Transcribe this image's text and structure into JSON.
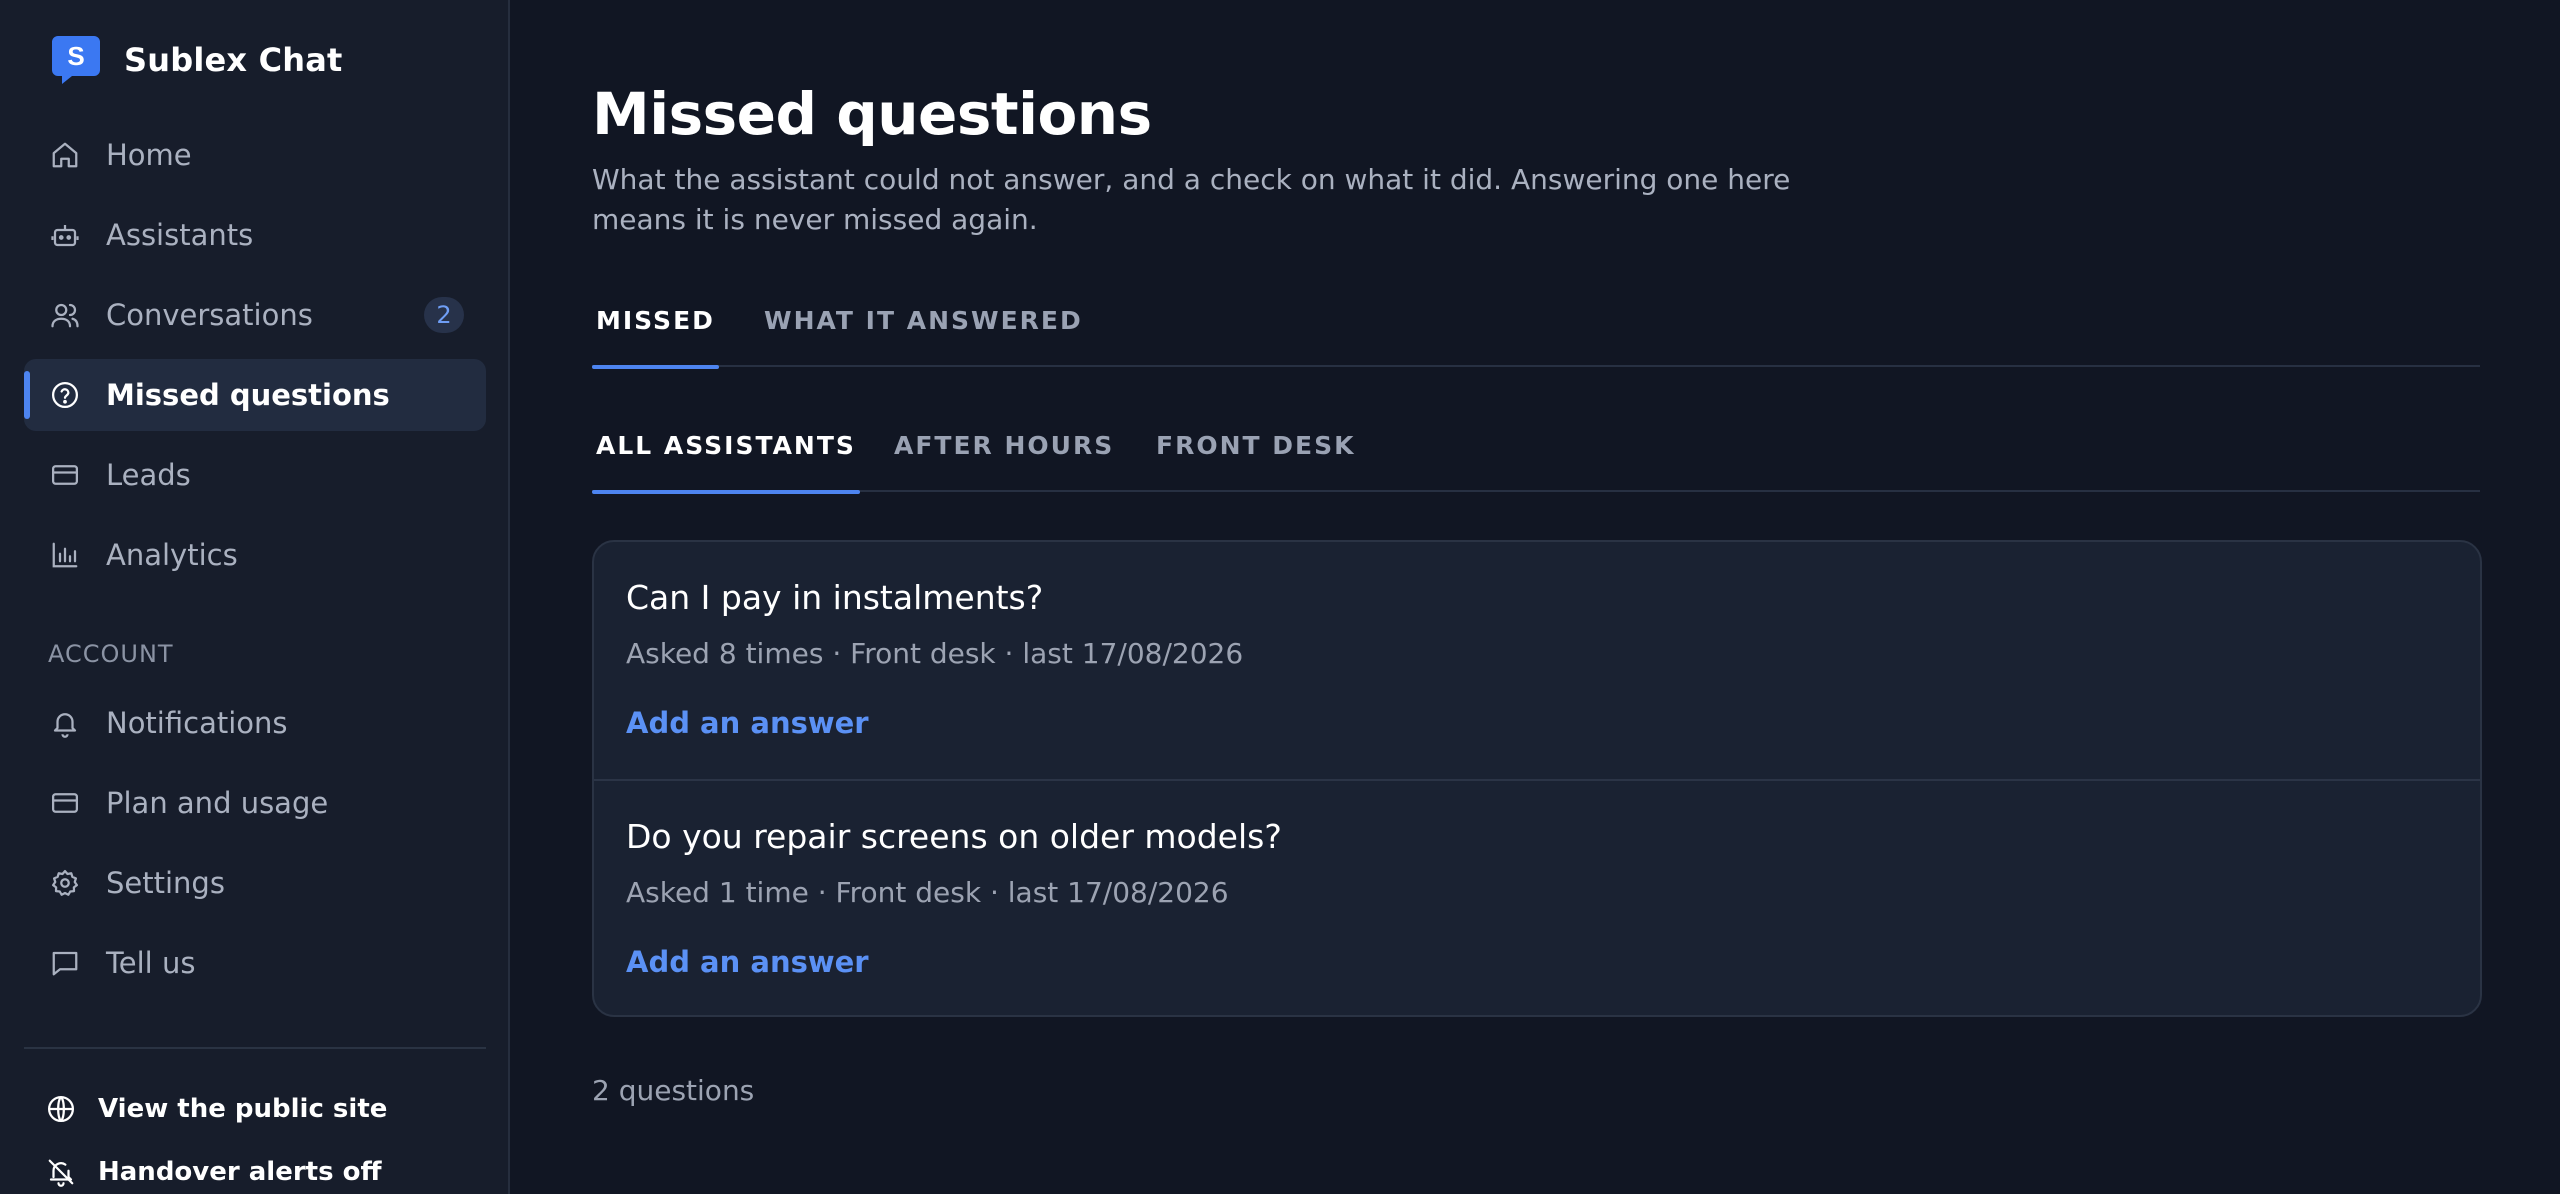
{
  "brand": {
    "name": "Sublex Chat",
    "logo_letter": "S"
  },
  "sidebar": {
    "items": [
      {
        "label": "Home",
        "icon": "home-icon"
      },
      {
        "label": "Assistants",
        "icon": "robot-icon"
      },
      {
        "label": "Conversations",
        "icon": "users-icon",
        "badge": "2"
      },
      {
        "label": "Missed questions",
        "icon": "help-circle-icon",
        "active": true
      },
      {
        "label": "Leads",
        "icon": "card-icon"
      },
      {
        "label": "Analytics",
        "icon": "bar-chart-icon"
      }
    ],
    "section_label": "ACCOUNT",
    "account_items": [
      {
        "label": "Notifications",
        "icon": "bell-icon"
      },
      {
        "label": "Plan and usage",
        "icon": "card-icon"
      },
      {
        "label": "Settings",
        "icon": "gear-icon"
      },
      {
        "label": "Tell us",
        "icon": "message-icon"
      }
    ],
    "footer": [
      {
        "label": "View the public site",
        "icon": "globe-icon"
      },
      {
        "label": "Handover alerts off",
        "icon": "bell-off-icon"
      }
    ]
  },
  "page": {
    "title": "Missed questions",
    "subtitle": "What the assistant could not answer, and a check on what it did. Answering one here means it is never missed again."
  },
  "tabs_primary": [
    {
      "label": "MISSED",
      "active": true
    },
    {
      "label": "WHAT IT ANSWERED",
      "active": false
    }
  ],
  "tabs_secondary": [
    {
      "label": "ALL ASSISTANTS",
      "active": true
    },
    {
      "label": "AFTER HOURS",
      "active": false
    },
    {
      "label": "FRONT DESK",
      "active": false
    }
  ],
  "questions": [
    {
      "title": "Can I pay in instalments?",
      "meta": "Asked 8 times · Front desk · last 17/08/2026",
      "action": "Add an answer"
    },
    {
      "title": "Do you repair screens on older models?",
      "meta": "Asked 1 time · Front desk · last 17/08/2026",
      "action": "Add an answer"
    }
  ],
  "count_label": "2 questions",
  "colors": {
    "accent": "#4d84f0",
    "link": "#5b91f5",
    "background": "#111623",
    "sidebar": "#171d2b"
  }
}
